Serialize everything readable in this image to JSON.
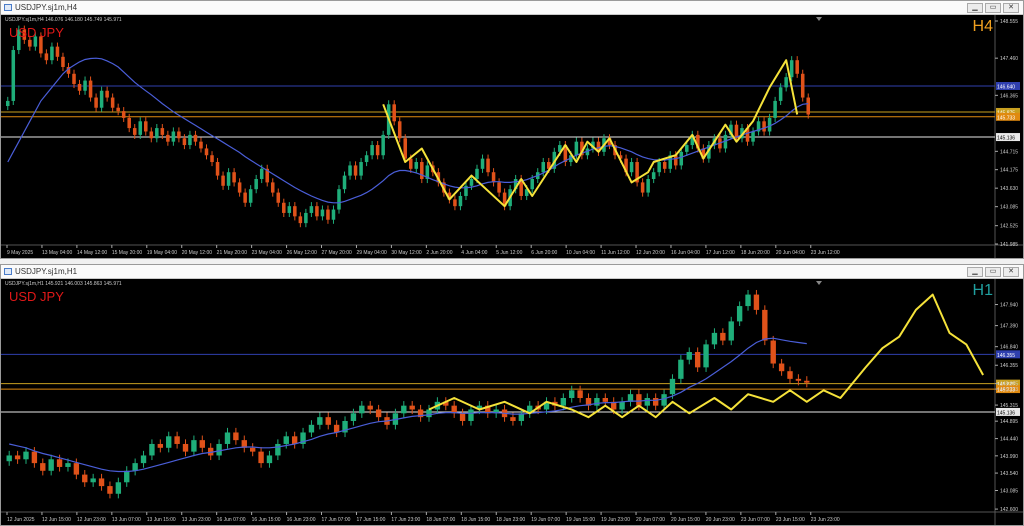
{
  "windows": [
    {
      "id": "h4",
      "title": "USDJPY.sj1m,H4",
      "info": "USDJPY.sj1m,H4  146.076 146.180 145.749 145.971",
      "symbol": "USD JPY",
      "timeframe": "H4",
      "timeframe_color": "#f0a020",
      "price_min": 141.985,
      "price_max": 148.555,
      "yticks": [
        "148.555",
        "147.460",
        "146.365",
        "144.715",
        "144.175",
        "143.630",
        "143.085",
        "142.525",
        "141.985"
      ],
      "yticks_values": [
        148.555,
        147.46,
        146.365,
        144.715,
        144.175,
        143.63,
        143.085,
        142.525,
        141.985
      ],
      "xticks": [
        "9 May 2025",
        "13 May 04:00",
        "14 May 12:00",
        "15 May 20:00",
        "19 May 04:00",
        "20 May 12:00",
        "21 May 20:00",
        "23 May 04:00",
        "26 May 12:00",
        "27 May 20:00",
        "29 May 04:00",
        "30 May 12:00",
        "2 Jun 20:00",
        "4 Jun 04:00",
        "5 Jun 12:00",
        "6 Jun 20:00",
        "10 Jun 04:00",
        "11 Jun 12:00",
        "12 Jun 20:00",
        "16 Jun 04:00",
        "17 Jun 12:00",
        "18 Jun 20:00",
        "20 Jun 04:00",
        "23 Jun 12:00"
      ],
      "levels": [
        {
          "price": 146.64,
          "color": "#2f3fae",
          "label": "146.640"
        },
        {
          "price": 145.875,
          "color": "#c8a020",
          "label": "145.875"
        },
        {
          "price": 145.733,
          "color": "#e08a10",
          "label": "145.733"
        },
        {
          "price": 145.136,
          "color": "#e8e8e8",
          "label": "145.136"
        }
      ],
      "closes": [
        146.2,
        147.7,
        148.3,
        148.0,
        147.8,
        148.1,
        147.6,
        147.4,
        147.8,
        147.5,
        147.2,
        147.0,
        146.7,
        146.5,
        146.8,
        146.3,
        146.0,
        146.5,
        146.3,
        146.0,
        145.9,
        145.7,
        145.4,
        145.2,
        145.6,
        145.3,
        145.1,
        145.4,
        145.2,
        145.0,
        145.3,
        145.1,
        144.9,
        145.2,
        145.0,
        144.8,
        144.6,
        144.4,
        144.0,
        143.7,
        144.1,
        143.8,
        143.5,
        143.2,
        143.6,
        143.9,
        144.2,
        143.8,
        143.5,
        143.2,
        142.9,
        143.1,
        142.8,
        142.6,
        142.9,
        143.1,
        142.8,
        143.0,
        142.7,
        143.0,
        143.6,
        144.0,
        144.3,
        144.0,
        144.4,
        144.6,
        144.9,
        144.6,
        145.2,
        146.1,
        145.6,
        145.1,
        144.5,
        144.2,
        144.4,
        143.9,
        144.3,
        144.1,
        143.8,
        143.5,
        143.3,
        143.1,
        143.4,
        143.7,
        143.9,
        144.2,
        144.5,
        144.1,
        143.8,
        143.5,
        143.1,
        143.6,
        143.9,
        143.4,
        143.6,
        143.9,
        144.1,
        144.4,
        144.2,
        144.7,
        144.9,
        144.4,
        144.6,
        145.0,
        144.6,
        144.8,
        145.0,
        144.7,
        145.1,
        144.9,
        144.6,
        144.5,
        144.1,
        144.4,
        143.8,
        143.5,
        143.9,
        144.1,
        144.4,
        144.2,
        144.6,
        144.3,
        144.7,
        144.9,
        145.2,
        144.8,
        144.5,
        144.9,
        145.1,
        144.8,
        145.2,
        145.5,
        145.1,
        145.4,
        145.0,
        145.3,
        145.6,
        145.3,
        145.7,
        146.2,
        146.6,
        146.9,
        147.4,
        147.0,
        146.3,
        145.8
      ],
      "ma": [
        144.4,
        144.7,
        145.0,
        145.3,
        145.6,
        145.9,
        146.2,
        146.4,
        146.6,
        146.8,
        147.0,
        147.15,
        147.25,
        147.35,
        147.42,
        147.45,
        147.46,
        147.44,
        147.38,
        147.3,
        147.2,
        147.05,
        146.9,
        146.75,
        146.62,
        146.5,
        146.38,
        146.25,
        146.12,
        146.0,
        145.88,
        145.78,
        145.68,
        145.58,
        145.48,
        145.38,
        145.28,
        145.18,
        145.08,
        144.98,
        144.88,
        144.78,
        144.68,
        144.56,
        144.45,
        144.35,
        144.25,
        144.15,
        144.05,
        143.95,
        143.85,
        143.75,
        143.65,
        143.56,
        143.48,
        143.4,
        143.33,
        143.27,
        143.22,
        143.2,
        143.2,
        143.24,
        143.3,
        143.36,
        143.42,
        143.5,
        143.6,
        143.72,
        143.85,
        144.0,
        144.1,
        144.15,
        144.15,
        144.12,
        144.08,
        144.02,
        143.95,
        143.88,
        143.82,
        143.76,
        143.7,
        143.66,
        143.64,
        143.64,
        143.66,
        143.7,
        143.76,
        143.8,
        143.82,
        143.82,
        143.8,
        143.8,
        143.82,
        143.84,
        143.88,
        143.94,
        144.0,
        144.08,
        144.16,
        144.26,
        144.36,
        144.44,
        144.52,
        144.6,
        144.66,
        144.72,
        144.78,
        144.82,
        144.86,
        144.88,
        144.86,
        144.82,
        144.76,
        144.7,
        144.62,
        144.55,
        144.5,
        144.47,
        144.46,
        144.46,
        144.48,
        144.5,
        144.54,
        144.6,
        144.66,
        144.72,
        144.78,
        144.84,
        144.9,
        144.96,
        145.02,
        145.08,
        145.14,
        145.2,
        145.25,
        145.3,
        145.35,
        145.4,
        145.46,
        145.54,
        145.64,
        145.76,
        145.9,
        146.02,
        146.1,
        146.12
      ],
      "zigzag_start": 68,
      "zigzag": [
        [
          68,
          146.1
        ],
        [
          72,
          144.4
        ],
        [
          75,
          144.8
        ],
        [
          80,
          143.3
        ],
        [
          84,
          144.0
        ],
        [
          90,
          143.1
        ],
        [
          93,
          143.9
        ],
        [
          95,
          143.4
        ],
        [
          99,
          144.4
        ],
        [
          101,
          144.9
        ],
        [
          103,
          144.4
        ],
        [
          105,
          145.0
        ],
        [
          107,
          144.7
        ],
        [
          109,
          145.1
        ],
        [
          113,
          143.8
        ],
        [
          116,
          144.1
        ],
        [
          117,
          144.4
        ],
        [
          121,
          144.6
        ],
        [
          124,
          145.2
        ],
        [
          126,
          144.5
        ],
        [
          130,
          145.5
        ],
        [
          132,
          145.0
        ],
        [
          135,
          145.6
        ],
        [
          138,
          146.6
        ],
        [
          141,
          147.4
        ],
        [
          143,
          145.8
        ]
      ]
    },
    {
      "id": "h1",
      "title": "USDJPY.sj1m,H1",
      "info": "USDJPY.sj1m,H1  145.921 146.003 145.863 145.971",
      "symbol": "USD JPY",
      "timeframe": "H1",
      "timeframe_color": "#20a0a0",
      "price_min": 142.55,
      "price_max": 148.45,
      "yticks": [
        "147.940",
        "147.390",
        "146.840",
        "146.355",
        "145.875",
        "145.733",
        "145.315",
        "144.895",
        "144.440",
        "143.990",
        "143.540",
        "143.085",
        "142.600"
      ],
      "yticks_values": [
        147.94,
        147.39,
        146.84,
        146.355,
        145.875,
        145.733,
        145.315,
        144.895,
        144.44,
        143.99,
        143.54,
        143.085,
        142.6
      ],
      "xticks": [
        "12 Jun 2025",
        "12 Jun 15:00",
        "12 Jun 23:00",
        "13 Jun 07:00",
        "13 Jun 15:00",
        "13 Jun 23:00",
        "16 Jun 07:00",
        "16 Jun 15:00",
        "16 Jun 23:00",
        "17 Jun 07:00",
        "17 Jun 15:00",
        "17 Jun 23:00",
        "18 Jun 07:00",
        "18 Jun 15:00",
        "18 Jun 23:00",
        "19 Jun 07:00",
        "19 Jun 15:00",
        "19 Jun 23:00",
        "20 Jun 07:00",
        "20 Jun 15:00",
        "20 Jun 23:00",
        "23 Jun 07:00",
        "23 Jun 15:00",
        "23 Jun 23:00"
      ],
      "levels": [
        {
          "price": 146.64,
          "color": "#2f3fae",
          "label": "146.355"
        },
        {
          "price": 145.875,
          "color": "#c8a020",
          "label": "145.875"
        },
        {
          "price": 145.733,
          "color": "#e08a10",
          "label": "145.733"
        },
        {
          "price": 145.136,
          "color": "#e8e8e8",
          "label": "145.136"
        }
      ],
      "closes": [
        144.0,
        143.9,
        144.1,
        143.8,
        143.6,
        143.9,
        143.7,
        143.8,
        143.5,
        143.3,
        143.4,
        143.2,
        143.0,
        143.3,
        143.6,
        143.8,
        144.0,
        144.3,
        144.2,
        144.5,
        144.3,
        144.1,
        144.4,
        144.2,
        144.0,
        144.3,
        144.6,
        144.4,
        144.2,
        144.1,
        143.8,
        144.0,
        144.3,
        144.5,
        144.3,
        144.6,
        144.8,
        145.0,
        144.8,
        144.6,
        144.9,
        145.1,
        145.3,
        145.2,
        145.0,
        144.8,
        145.1,
        145.3,
        145.2,
        145.0,
        145.2,
        145.4,
        145.3,
        145.1,
        144.9,
        145.2,
        145.3,
        145.1,
        145.2,
        145.0,
        144.9,
        145.1,
        145.3,
        145.2,
        145.4,
        145.3,
        145.5,
        145.7,
        145.5,
        145.3,
        145.5,
        145.4,
        145.2,
        145.4,
        145.6,
        145.3,
        145.5,
        145.3,
        145.6,
        146.0,
        146.5,
        146.7,
        146.3,
        146.9,
        147.2,
        147.0,
        147.5,
        147.9,
        148.2,
        147.8,
        147.0,
        146.4,
        146.2,
        146.0,
        145.95,
        145.9
      ],
      "ma": [
        144.3,
        144.25,
        144.2,
        144.12,
        144.05,
        144.0,
        143.94,
        143.88,
        143.82,
        143.76,
        143.7,
        143.64,
        143.6,
        143.58,
        143.58,
        143.6,
        143.64,
        143.7,
        143.76,
        143.82,
        143.88,
        143.94,
        144.0,
        144.05,
        144.08,
        144.12,
        144.16,
        144.2,
        144.22,
        144.22,
        144.2,
        144.2,
        144.22,
        144.26,
        144.3,
        144.36,
        144.42,
        144.5,
        144.56,
        144.6,
        144.66,
        144.72,
        144.78,
        144.84,
        144.88,
        144.9,
        144.94,
        144.98,
        145.02,
        145.04,
        145.06,
        145.1,
        145.12,
        145.12,
        145.1,
        145.1,
        145.12,
        145.12,
        145.12,
        145.1,
        145.08,
        145.08,
        145.1,
        145.12,
        145.14,
        145.16,
        145.2,
        145.26,
        145.3,
        145.32,
        145.36,
        145.38,
        145.38,
        145.4,
        145.42,
        145.42,
        145.44,
        145.44,
        145.48,
        145.55,
        145.65,
        145.78,
        145.88,
        146.0,
        146.15,
        146.3,
        146.45,
        146.62,
        146.8,
        146.95,
        147.04,
        147.06,
        147.02,
        146.98,
        146.95,
        146.92
      ],
      "zigzag_start": 50,
      "zigzag": [
        [
          50,
          145.2
        ],
        [
          53,
          145.5
        ],
        [
          56,
          145.2
        ],
        [
          59,
          145.4
        ],
        [
          62,
          145.1
        ],
        [
          64,
          145.4
        ],
        [
          67,
          145.2
        ],
        [
          69,
          145.0
        ],
        [
          71,
          145.3
        ],
        [
          73,
          145.0
        ],
        [
          75,
          145.3
        ],
        [
          77,
          145.0
        ],
        [
          79,
          145.4
        ],
        [
          81,
          145.1
        ],
        [
          84,
          145.5
        ],
        [
          86,
          145.2
        ],
        [
          88,
          145.6
        ],
        [
          91,
          145.4
        ],
        [
          93,
          145.7
        ],
        [
          95,
          145.4
        ],
        [
          97,
          145.7
        ],
        [
          99,
          145.5
        ],
        [
          102,
          146.3
        ],
        [
          104,
          146.8
        ],
        [
          106,
          147.1
        ],
        [
          108,
          147.8
        ],
        [
          110,
          148.2
        ],
        [
          112,
          147.2
        ],
        [
          114,
          146.9
        ],
        [
          116,
          146.1
        ]
      ]
    }
  ]
}
